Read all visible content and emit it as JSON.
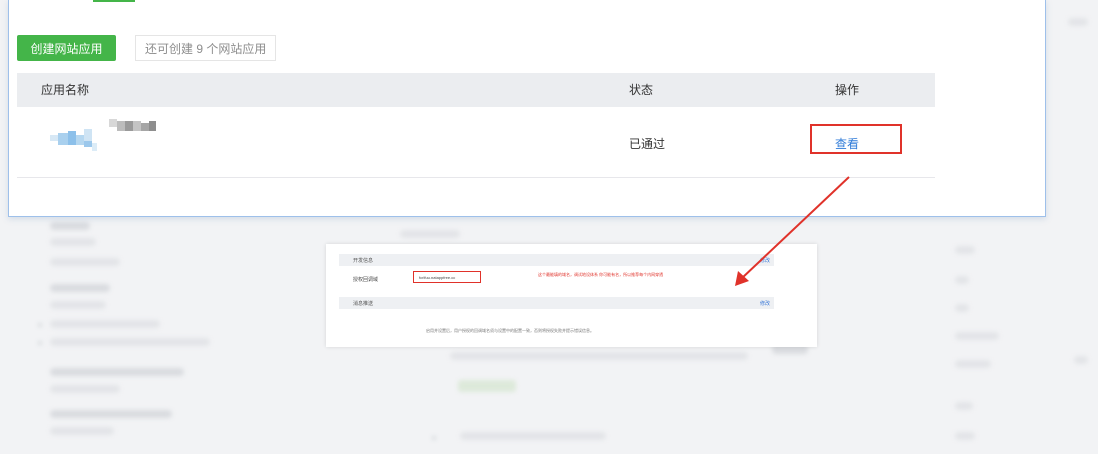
{
  "header": {
    "create_button_label": "创建网站应用",
    "quota_text": "还可创建 9 个网站应用"
  },
  "table": {
    "columns": [
      "应用名称",
      "状态",
      "操作"
    ],
    "rows": [
      {
        "status": "已通过",
        "action_label": "查看"
      }
    ]
  },
  "inset": {
    "section1_title": "开发信息",
    "section1_link": "修改",
    "field_label": "授权回调域",
    "field_value": "fcrlfuu.natappfree.cc",
    "annotation": "这个最能填的域名，调试地设体系 你可能有名，所以推荐每个内网穿透",
    "section2_title": "消息推送",
    "section2_link": "修改",
    "footer_text": "启用并设置后，用户授权的回调域名须与设置中的配置一致，否则将授权失败并提示错误信息。"
  },
  "colors": {
    "primary_green": "#44b549",
    "link_blue": "#2f7bd8",
    "annotation_red": "#e0322a"
  }
}
